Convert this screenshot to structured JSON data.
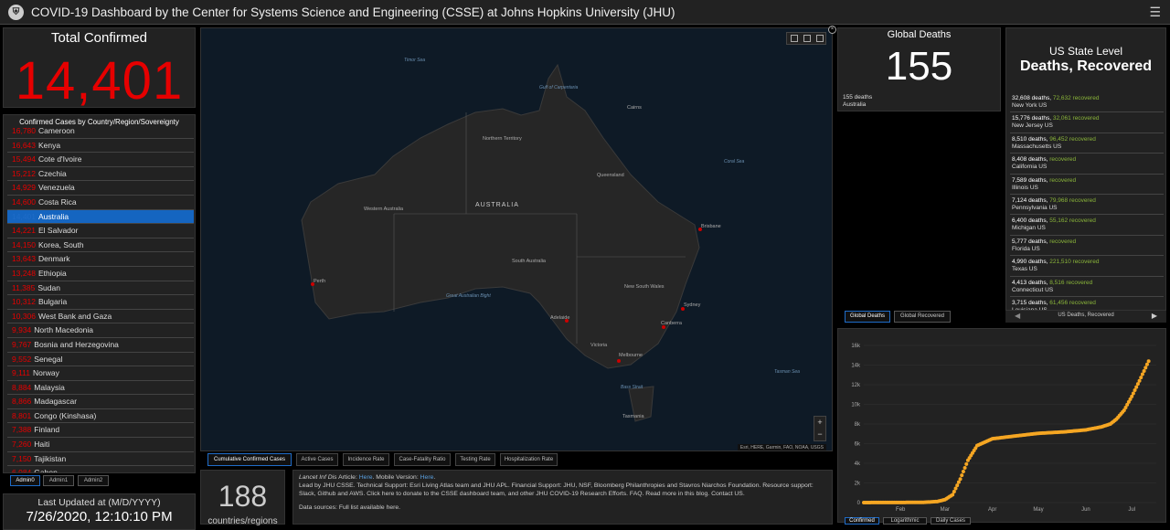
{
  "header": {
    "title": "COVID-19 Dashboard by the Center for Systems Science and Engineering (CSSE) at Johns Hopkins University (JHU)",
    "menu_icon": "hamburger-icon"
  },
  "total": {
    "label": "Total Confirmed",
    "value": "14,401"
  },
  "list": {
    "heading": "Confirmed Cases by Country/Region/Sovereignty",
    "rows": [
      {
        "value": "16,780",
        "country": "Cameroon"
      },
      {
        "value": "16,643",
        "country": "Kenya"
      },
      {
        "value": "15,494",
        "country": "Cote d'Ivoire"
      },
      {
        "value": "15,212",
        "country": "Czechia"
      },
      {
        "value": "14,929",
        "country": "Venezuela"
      },
      {
        "value": "14,600",
        "country": "Costa Rica"
      },
      {
        "value": "14,401",
        "country": "Australia",
        "selected": true
      },
      {
        "value": "14,221",
        "country": "El Salvador"
      },
      {
        "value": "14,150",
        "country": "Korea, South"
      },
      {
        "value": "13,643",
        "country": "Denmark"
      },
      {
        "value": "13,248",
        "country": "Ethiopia"
      },
      {
        "value": "11,385",
        "country": "Sudan"
      },
      {
        "value": "10,312",
        "country": "Bulgaria"
      },
      {
        "value": "10,306",
        "country": "West Bank and Gaza"
      },
      {
        "value": "9,934",
        "country": "North Macedonia"
      },
      {
        "value": "9,767",
        "country": "Bosnia and Herzegovina"
      },
      {
        "value": "9,552",
        "country": "Senegal"
      },
      {
        "value": "9,111",
        "country": "Norway"
      },
      {
        "value": "8,884",
        "country": "Malaysia"
      },
      {
        "value": "8,866",
        "country": "Madagascar"
      },
      {
        "value": "8,801",
        "country": "Congo (Kinshasa)"
      },
      {
        "value": "7,388",
        "country": "Finland"
      },
      {
        "value": "7,260",
        "country": "Haiti"
      },
      {
        "value": "7,150",
        "country": "Tajikistan"
      },
      {
        "value": "6,984",
        "country": "Gabon"
      }
    ]
  },
  "admin_tabs": [
    "Admin0",
    "Admin1",
    "Admin2"
  ],
  "updated": {
    "label": "Last Updated at (M/D/YYYY)",
    "time": "7/26/2020, 12:10:10 PM"
  },
  "map": {
    "country_label": "AUSTRALIA",
    "regions": [
      "Northern Territory",
      "Western Australia",
      "Queensland",
      "South Australia",
      "New South Wales",
      "Victoria",
      "Tasmania"
    ],
    "seas": [
      "Timor Sea",
      "Gulf of Carpentaria",
      "Coral Sea",
      "Great Australian Bight",
      "Bass Strait",
      "Tasman Sea"
    ],
    "cities": [
      "Cairns",
      "Brisbane",
      "Perth",
      "Sydney",
      "Canberra",
      "Adelaide",
      "Melbourne"
    ],
    "attribution": "Esri, HERE, Garmin, FAO, NOAA, USGS",
    "zoom_in": "+",
    "zoom_out": "−"
  },
  "map_tabs": [
    "Cumulative Confirmed Cases",
    "Active Cases",
    "Incidence Rate",
    "Case-Fatality Ratio",
    "Testing Rate",
    "Hospitalization Rate"
  ],
  "countries": {
    "value": "188",
    "label": "countries/regions"
  },
  "info": {
    "line1_lead": "Lancet Inf Dis",
    "line1_mid": " Article: ",
    "here1": "Here",
    "line1_mobile": ". Mobile Version: ",
    "here2": "Here",
    "line2": "Lead by JHU CSSE. Technical Support: Esri Living Atlas team and JHU APL. Financial Support: JHU, NSF, Bloomberg Philanthropies and Stavros Niarchos Foundation. Resource support: Slack, Github and AWS. Click here to donate to the CSSE dashboard team, and other JHU COVID-19 Research Efforts. FAQ. Read more in this blog. Contact US.",
    "line3": "Data sources: Full list available here."
  },
  "deaths": {
    "label": "Global Deaths",
    "value": "155",
    "sub_value": "155 deaths",
    "sub_place": "Australia"
  },
  "state": {
    "title1": "US State Level",
    "title2": "Deaths, Recovered",
    "rows": [
      {
        "deaths": "32,608 deaths,",
        "recovered": "72,632",
        "rec_label": "recovered",
        "state": "New York US"
      },
      {
        "deaths": "15,776 deaths,",
        "recovered": "32,061",
        "rec_label": "recovered",
        "state": "New Jersey US"
      },
      {
        "deaths": "8,510 deaths,",
        "recovered": "96,452",
        "rec_label": "recovered",
        "state": "Massachusetts US"
      },
      {
        "deaths": "8,408 deaths,",
        "recovered": "",
        "rec_label": "recovered",
        "state": "California US"
      },
      {
        "deaths": "7,589 deaths,",
        "recovered": "",
        "rec_label": "recovered",
        "state": "Illinois US"
      },
      {
        "deaths": "7,124 deaths,",
        "recovered": "79,968",
        "rec_label": "recovered",
        "state": "Pennsylvania US"
      },
      {
        "deaths": "6,400 deaths,",
        "recovered": "55,162",
        "rec_label": "recovered",
        "state": "Michigan US"
      },
      {
        "deaths": "5,777 deaths,",
        "recovered": "",
        "rec_label": "recovered",
        "state": "Florida US"
      },
      {
        "deaths": "4,990 deaths,",
        "recovered": "221,510",
        "rec_label": "recovered",
        "state": "Texas US"
      },
      {
        "deaths": "4,413 deaths,",
        "recovered": "8,516",
        "rec_label": "recovered",
        "state": "Connecticut US"
      },
      {
        "deaths": "3,715 deaths,",
        "recovered": "61,456",
        "rec_label": "recovered",
        "state": "Louisiana US"
      }
    ],
    "nav_label": "US Deaths, Recovered"
  },
  "chart_tabs": [
    "Global Deaths",
    "Global Recovered"
  ],
  "chart_bottom_tabs": [
    "Confirmed",
    "Logarithmic",
    "Daily Cases"
  ],
  "chart_data": {
    "type": "scatter",
    "title": "",
    "xlabel": "",
    "ylabel": "",
    "x_ticks": [
      "Feb",
      "Mar",
      "Apr",
      "May",
      "Jun",
      "Jul"
    ],
    "y_ticks": [
      "0",
      "2k",
      "4k",
      "6k",
      "8k",
      "10k",
      "12k",
      "14k",
      "16k"
    ],
    "ylim": [
      0,
      16000
    ],
    "color": "#f5a623",
    "series": [
      {
        "x": [
          "2020-01-22",
          "2020-02-01",
          "2020-02-15",
          "2020-03-01",
          "2020-03-10",
          "2020-03-15",
          "2020-03-20",
          "2020-03-25",
          "2020-03-30",
          "2020-04-05",
          "2020-04-15",
          "2020-05-01",
          "2020-05-15",
          "2020-06-01",
          "2020-06-15",
          "2020-06-25",
          "2020-07-01",
          "2020-07-05",
          "2020-07-10",
          "2020-07-15",
          "2020-07-20",
          "2020-07-23",
          "2020-07-26"
        ],
        "y": [
          0,
          12,
          15,
          27,
          110,
          300,
          800,
          2400,
          4300,
          5800,
          6500,
          6800,
          7050,
          7200,
          7400,
          7700,
          8000,
          8500,
          9400,
          10800,
          12400,
          13400,
          14401
        ]
      }
    ]
  }
}
